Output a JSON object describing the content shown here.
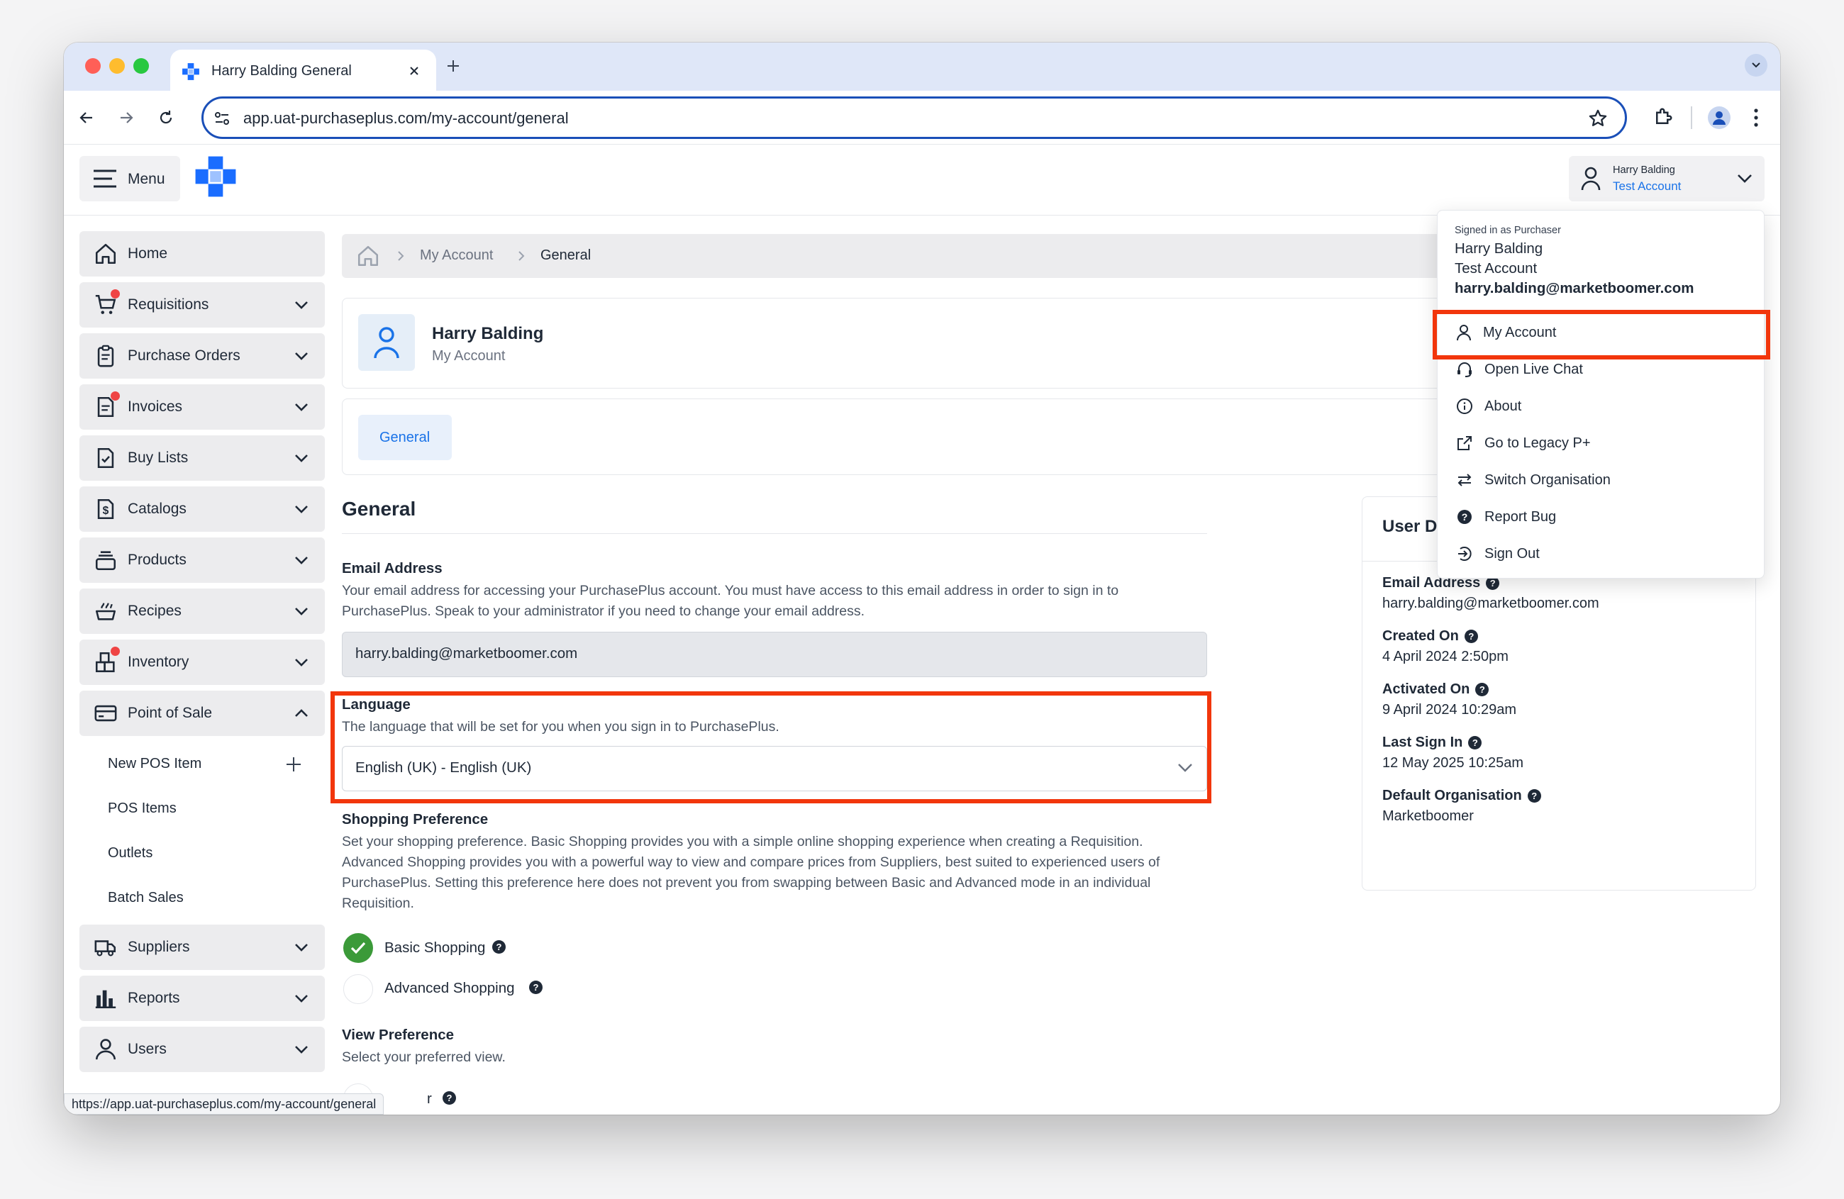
{
  "browser": {
    "tab_title": "Harry Balding General",
    "url": "app.uat-purchaseplus.com/my-account/general",
    "status_url": "https://app.uat-purchaseplus.com/my-account/general"
  },
  "header": {
    "menu_label": "Menu",
    "user_name": "Harry Balding",
    "user_org": "Test Account"
  },
  "sidebar": {
    "items": [
      {
        "label": "Home"
      },
      {
        "label": "Requisitions"
      },
      {
        "label": "Purchase Orders"
      },
      {
        "label": "Invoices"
      },
      {
        "label": "Buy Lists"
      },
      {
        "label": "Catalogs"
      },
      {
        "label": "Products"
      },
      {
        "label": "Recipes"
      },
      {
        "label": "Inventory"
      },
      {
        "label": "Point of Sale"
      }
    ],
    "pos_sub": [
      "New POS Item",
      "POS Items",
      "Outlets",
      "Batch Sales"
    ],
    "bottom": [
      {
        "label": "Suppliers"
      },
      {
        "label": "Reports"
      },
      {
        "label": "Users"
      }
    ]
  },
  "breadcrumb": {
    "level1": "My Account",
    "level2": "General"
  },
  "profile": {
    "name": "Harry Balding",
    "subtitle": "My Account"
  },
  "tabs": {
    "general": "General"
  },
  "general": {
    "heading": "General",
    "email_label": "Email Address",
    "email_help": "Your email address for accessing your PurchasePlus account. You must have access to this email address in order to sign in to PurchasePlus. Speak to your administrator if you need to change your email address.",
    "email_value": "harry.balding@marketboomer.com",
    "language_label": "Language",
    "language_help": "The language that will be set for you when you sign in to PurchasePlus.",
    "language_value": "English (UK) - English (UK)",
    "shopping_label": "Shopping Preference",
    "shopping_help": "Set your shopping preference. Basic Shopping provides you with a simple online shopping experience when creating a Requisition. Advanced Shopping provides you with a powerful way to view and compare prices from Suppliers, best suited to experienced users of PurchasePlus. Setting this preference here does not prevent you from swapping between Basic and Advanced mode in an individual Requisition.",
    "basic_shopping": "Basic Shopping",
    "advanced_shopping": "Advanced Shopping",
    "view_label": "View Preference",
    "view_help": "Select your preferred view.",
    "view_option_partial": "r"
  },
  "user_details": {
    "title_partial": "User D",
    "email_label": "Email Address",
    "email_value": "harry.balding@marketboomer.com",
    "created_label": "Created On",
    "created_value": "4 April 2024 2:50pm",
    "activated_label": "Activated On",
    "activated_value": "9 April 2024 10:29am",
    "last_sign_label": "Last Sign In",
    "last_sign_value": "12 May 2025 10:25am",
    "org_label": "Default Organisation",
    "org_value": "Marketboomer"
  },
  "dropdown": {
    "signed_in_as": "Signed in as Purchaser",
    "name": "Harry Balding",
    "account": "Test Account",
    "email": "harry.balding@marketboomer.com",
    "items": [
      "My Account",
      "Open Live Chat",
      "About",
      "Go to Legacy P+",
      "Switch Organisation",
      "Report Bug",
      "Sign Out"
    ]
  },
  "colors": {
    "accent": "#1a73e8",
    "highlight": "#f2360c",
    "success": "#3b9a39",
    "brand": "#1a6dff"
  }
}
